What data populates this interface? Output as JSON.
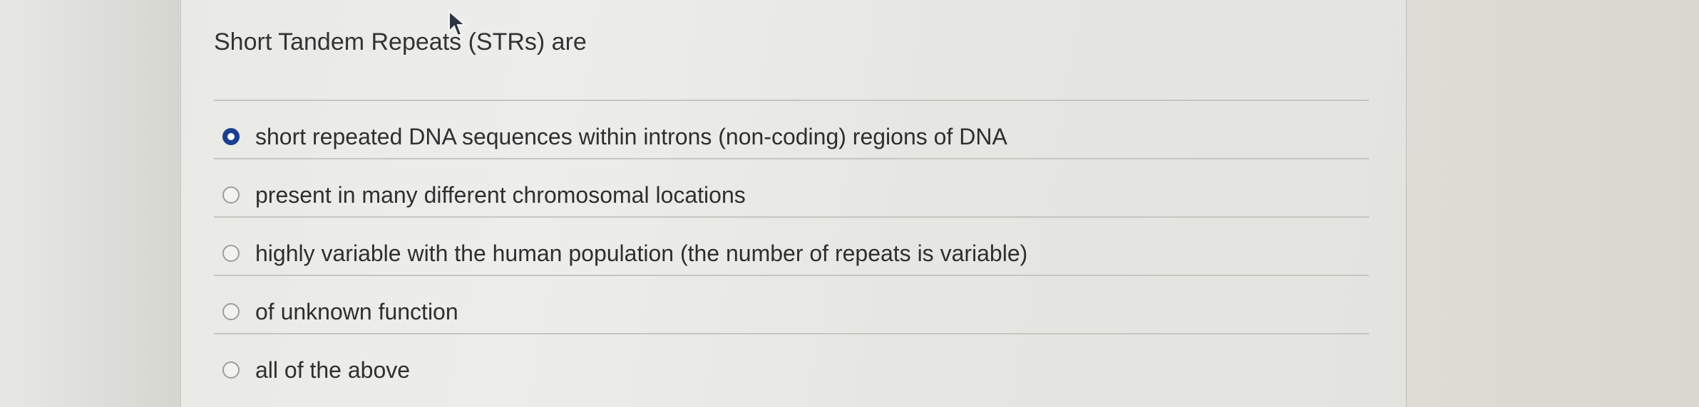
{
  "question": {
    "text": "Short Tandem Repeats (STRs) are"
  },
  "options": [
    {
      "label": "short repeated DNA sequences within introns (non-coding) regions of DNA",
      "selected": true
    },
    {
      "label": "present in many different chromosomal locations",
      "selected": false
    },
    {
      "label": "highly variable with the human population (the number of repeats is variable)",
      "selected": false
    },
    {
      "label": "of unknown function",
      "selected": false
    },
    {
      "label": "all of the above",
      "selected": false
    }
  ],
  "colors": {
    "selected_radio": "#1b3f8f",
    "panel_bg": "#ebebe8",
    "text": "#2f2f2f"
  },
  "icons": {
    "cursor": "mouse-pointer-icon",
    "radio_selected": "radio-selected-icon",
    "radio_unselected": "radio-unselected-icon"
  }
}
